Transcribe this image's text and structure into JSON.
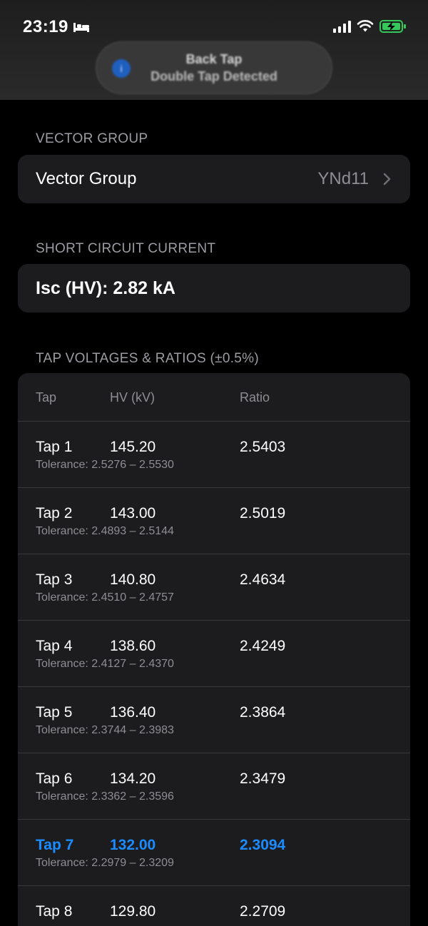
{
  "status_bar": {
    "time": "23:19",
    "icons": [
      "bed-icon",
      "signal-icon",
      "wifi-icon",
      "battery-charging-icon"
    ]
  },
  "banner": {
    "title": "Back Tap",
    "subtitle": "Double Tap Detected"
  },
  "vector_group": {
    "section_label": "VECTOR GROUP",
    "label": "Vector Group",
    "value": "YNd11"
  },
  "short_circuit": {
    "section_label": "SHORT CIRCUIT CURRENT",
    "value": "Isc (HV): 2.82 kA"
  },
  "taps": {
    "section_label": "TAP VOLTAGES & RATIOS (±0.5%)",
    "headers": {
      "tap": "Tap",
      "hv": "HV (kV)",
      "ratio": "Ratio"
    },
    "rows": [
      {
        "tap": "Tap 1",
        "hv": "145.20",
        "ratio": "2.5403",
        "tolerance": "Tolerance: 2.5276 – 2.5530"
      },
      {
        "tap": "Tap 2",
        "hv": "143.00",
        "ratio": "2.5019",
        "tolerance": "Tolerance: 2.4893 – 2.5144"
      },
      {
        "tap": "Tap 3",
        "hv": "140.80",
        "ratio": "2.4634",
        "tolerance": "Tolerance: 2.4510 – 2.4757"
      },
      {
        "tap": "Tap 4",
        "hv": "138.60",
        "ratio": "2.4249",
        "tolerance": "Tolerance: 2.4127 – 2.4370"
      },
      {
        "tap": "Tap 5",
        "hv": "136.40",
        "ratio": "2.3864",
        "tolerance": "Tolerance: 2.3744 – 2.3983"
      },
      {
        "tap": "Tap 6",
        "hv": "134.20",
        "ratio": "2.3479",
        "tolerance": "Tolerance: 2.3362 – 2.3596"
      },
      {
        "tap": "Tap 7",
        "hv": "132.00",
        "ratio": "2.3094",
        "tolerance": "Tolerance: 2.2979 – 2.3209",
        "active": true
      },
      {
        "tap": "Tap 8",
        "hv": "129.80",
        "ratio": "2.2709",
        "tolerance": ""
      }
    ]
  },
  "colors": {
    "background": "#000000",
    "card": "#1c1c1e",
    "secondary_text": "#8e8e93",
    "accent": "#1a8cff",
    "battery_green": "#34c759"
  }
}
